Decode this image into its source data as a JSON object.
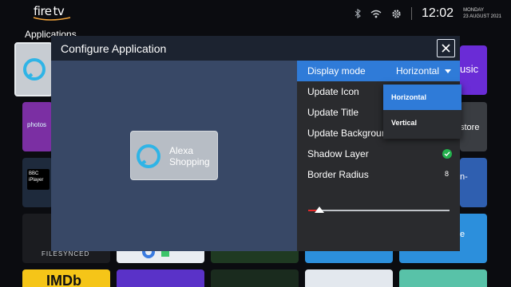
{
  "brand": {
    "line1": "fire",
    "line2": "tv"
  },
  "section_title": "Applications",
  "status": {
    "time": "12:02",
    "day": "MONDAY",
    "date": "23 AUGUST 2021",
    "icons": [
      "bluetooth-icon",
      "wifi-icon",
      "settings-gear-icon"
    ]
  },
  "background_tiles": [
    {
      "label": "usic"
    },
    {
      "label": "photos"
    },
    {
      "label": "store"
    },
    {
      "label": "BBC iPlayer"
    },
    {
      "label": "n-"
    },
    {
      "label": "s"
    },
    {
      "label": "FILESYNCED"
    },
    {
      "label": "e"
    },
    {
      "label": "IMDb"
    }
  ],
  "dialog": {
    "title": "Configure Application",
    "close_symbol": "✕",
    "preview": {
      "app_name": "Alexa Shopping"
    },
    "settings": {
      "display_mode": {
        "label": "Display mode",
        "value": "Horizontal"
      },
      "update_icon": "Update Icon",
      "update_title": "Update Title",
      "update_background": "Update Backgroun",
      "shadow_layer": {
        "label": "Shadow Layer",
        "enabled": true
      },
      "border_radius": {
        "label": "Border Radius",
        "value": "8",
        "level_fraction": 0.08
      }
    },
    "dropdown": {
      "options": [
        "Horizontal",
        "Vertical"
      ],
      "selected": "Horizontal"
    }
  },
  "colors": {
    "accent": "#2f7bd8",
    "dialog_body": "#384866",
    "dialog_header": "#1c2330",
    "panel": "#2a2b2e",
    "check": "#23b14d",
    "slider_fill": "#e52a2a"
  }
}
